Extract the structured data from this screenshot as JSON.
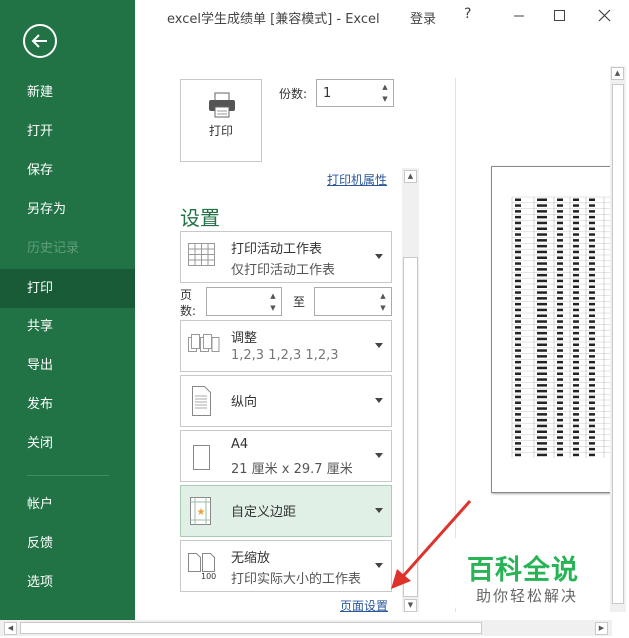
{
  "window": {
    "title": "excel学生成绩单  [兼容模式]  -  Excel",
    "login": "登录",
    "help": "?"
  },
  "sidebar": {
    "items": [
      {
        "label": "新建",
        "state": "normal"
      },
      {
        "label": "打开",
        "state": "normal"
      },
      {
        "label": "保存",
        "state": "normal"
      },
      {
        "label": "另存为",
        "state": "normal"
      },
      {
        "label": "历史记录",
        "state": "disabled"
      },
      {
        "label": "打印",
        "state": "selected"
      },
      {
        "label": "共享",
        "state": "normal"
      },
      {
        "label": "导出",
        "state": "normal"
      },
      {
        "label": "发布",
        "state": "normal"
      },
      {
        "label": "关闭",
        "state": "normal"
      },
      {
        "label": "帐户",
        "state": "normal"
      },
      {
        "label": "反馈",
        "state": "normal"
      },
      {
        "label": "选项",
        "state": "normal"
      }
    ]
  },
  "print": {
    "button_label": "打印",
    "copies_label": "份数:",
    "copies_value": "1",
    "printer_properties": "打印机属性",
    "settings_heading": "设置",
    "pages_label": "页\n数:",
    "to_label": "至",
    "page_setup": "页面设置",
    "options": {
      "what": {
        "title": "打印活动工作表",
        "sub": "仅打印活动工作表"
      },
      "collate": {
        "title": "调整",
        "sub": "1,2,3    1,2,3    1,2,3"
      },
      "orientation": {
        "title": "纵向",
        "sub": ""
      },
      "paper": {
        "title": "A4",
        "sub": "21 厘米 x 29.7 厘米"
      },
      "margins": {
        "title": "自定义边距",
        "sub": ""
      },
      "scaling": {
        "title": "无缩放",
        "sub": "打印实际大小的工作表"
      }
    },
    "scaling_icon_text": "100"
  },
  "watermark": {
    "line1": "百科全说",
    "line2": "助你轻松解决"
  },
  "colors": {
    "brand": "#217346",
    "selected": "#195a37",
    "link": "#2b579a",
    "arrow": "#e0322c"
  }
}
